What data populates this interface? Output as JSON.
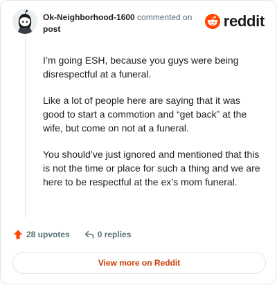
{
  "header": {
    "username": "Ok-Neighborhood-1600",
    "commented_text": "commented on",
    "post_link": "post",
    "logo_wordmark": "reddit"
  },
  "comment": {
    "paragraphs": [
      "I’m going ESH, because you guys were being disrespectful at a funeral.",
      "Like a lot of people here are saying that it was good to start a commotion and “get back” at the wife, but come on not at a funeral.",
      "You should’ve just ignored and mentioned that this is not the time or place for such a thing and we are here to be respectful at the ex’s mom funeral."
    ]
  },
  "actions": {
    "upvotes": "28 upvotes",
    "replies": "0 replies"
  },
  "footer": {
    "view_more": "View more on Reddit"
  },
  "colors": {
    "brand": "#ff4500",
    "link": "#c73a01",
    "muted": "#576f76",
    "text": "#1c1c1c",
    "border": "#e2e4e6"
  },
  "icons": {
    "avatar": "snoo-avatar",
    "logo": "reddit-snoo-icon",
    "upvote": "upvote-arrow-icon",
    "reply": "reply-arrow-icon"
  }
}
